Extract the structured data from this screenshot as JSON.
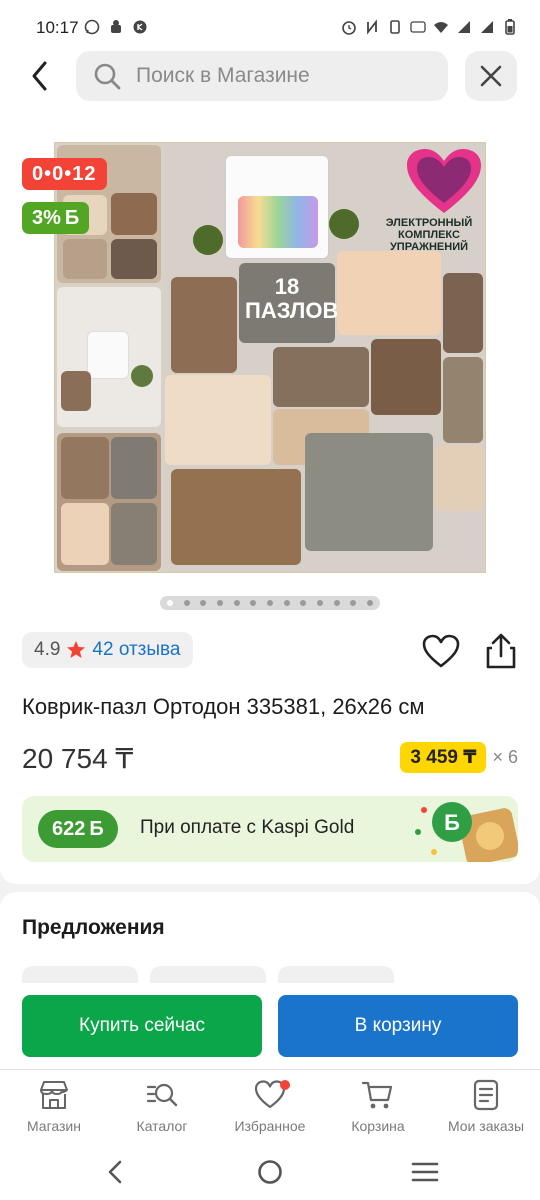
{
  "status_bar": {
    "time": "10:17",
    "left_icons": [
      "whatsapp-icon",
      "android-icon",
      "kaspi-icon"
    ],
    "right_icons": [
      "alarm-icon",
      "nfc-icon",
      "vibrate-icon",
      "volte-icon",
      "wifi-icon",
      "signal-icon",
      "signal-icon",
      "battery-icon"
    ]
  },
  "header": {
    "search_placeholder": "Поиск в Магазине"
  },
  "product": {
    "timer_badge": "0•0•12",
    "bonus_badge": "3%",
    "bonus_currency": "Б",
    "image_caption": "18 ПАЗЛОВ",
    "image_text": "ЭЛЕКТРОННЫЙ КОМПЛЕКС УПРАЖНЕНИЙ",
    "gallery_count": 13,
    "gallery_active": 0,
    "rating": "4.9",
    "reviews": "42 отзыва",
    "title": "Коврик-пазл Ортодон 335381, 26х26 см",
    "price": "20 754 ₸",
    "installment_amount": "3 459 ₸",
    "installment_term": "× 6",
    "gold_bonus": "622",
    "gold_bonus_currency": "Б",
    "gold_text": "При оплате с Kaspi Gold"
  },
  "offers": {
    "title": "Предложения"
  },
  "actions": {
    "buy_now": "Купить сейчас",
    "add_to_cart": "В корзину"
  },
  "tabbar": {
    "items": [
      {
        "label": "Магазин",
        "icon": "store-icon"
      },
      {
        "label": "Каталог",
        "icon": "catalog-icon"
      },
      {
        "label": "Избранное",
        "icon": "heart-icon"
      },
      {
        "label": "Корзина",
        "icon": "cart-icon"
      },
      {
        "label": "Мои заказы",
        "icon": "orders-icon"
      }
    ]
  },
  "colors": {
    "red": "#f24336",
    "green": "#0aa649",
    "blue": "#1a74cb",
    "yellow": "#ffd600",
    "link_blue": "#1a73c8"
  }
}
